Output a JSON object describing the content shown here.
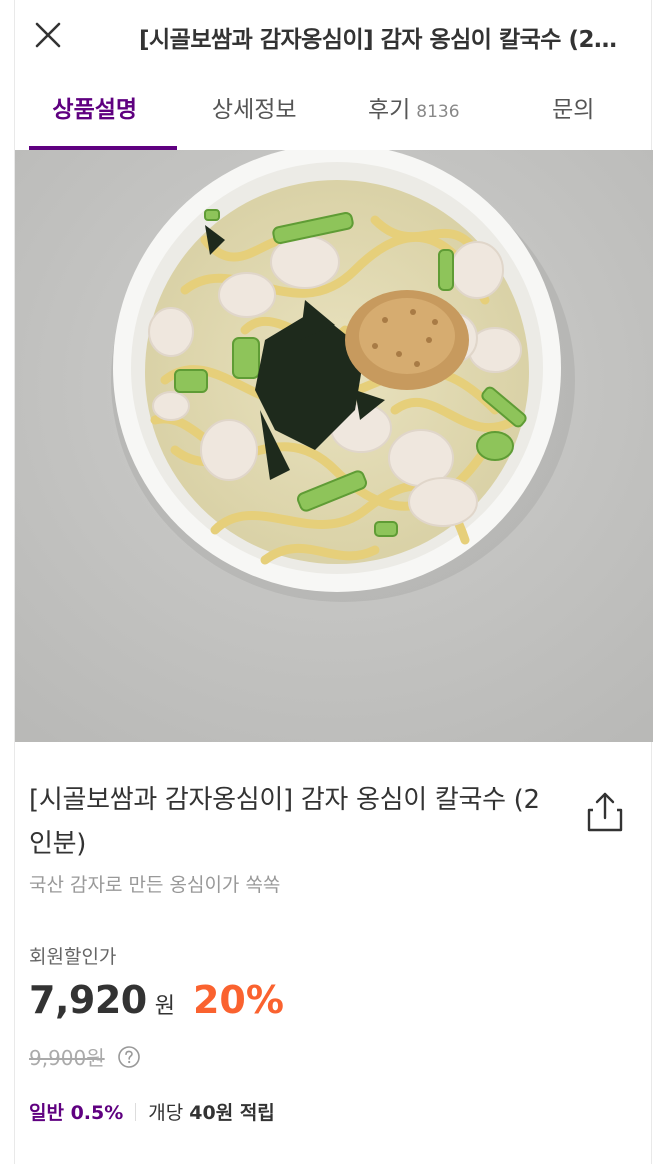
{
  "header": {
    "title": "[시골보쌈과 감자옹심이] 감자 옹심이 칼국수 (2인분)"
  },
  "tabs": [
    {
      "label": "상품설명",
      "active": true
    },
    {
      "label": "상세정보",
      "active": false
    },
    {
      "label": "후기",
      "count": "8136",
      "active": false
    },
    {
      "label": "문의",
      "active": false
    }
  ],
  "product": {
    "name": "[시골보쌈과 감자옹심이] 감자 옹심이 칼국수 (2인분)",
    "subtitle": "국산 감자로 만든 옹심이가 쏙쏙",
    "price_label": "회원할인가",
    "price": "7,920",
    "currency": "원",
    "discount": "20%",
    "original_price": "9,900원",
    "reward_tier": "일반 0.5%",
    "reward_prefix": "개당 ",
    "reward_amount": "40원 적립"
  },
  "colors": {
    "accent": "#5f0080",
    "discount": "#fa622f"
  },
  "icons": {
    "close": "close-icon",
    "share": "share-icon",
    "help": "help-icon"
  }
}
